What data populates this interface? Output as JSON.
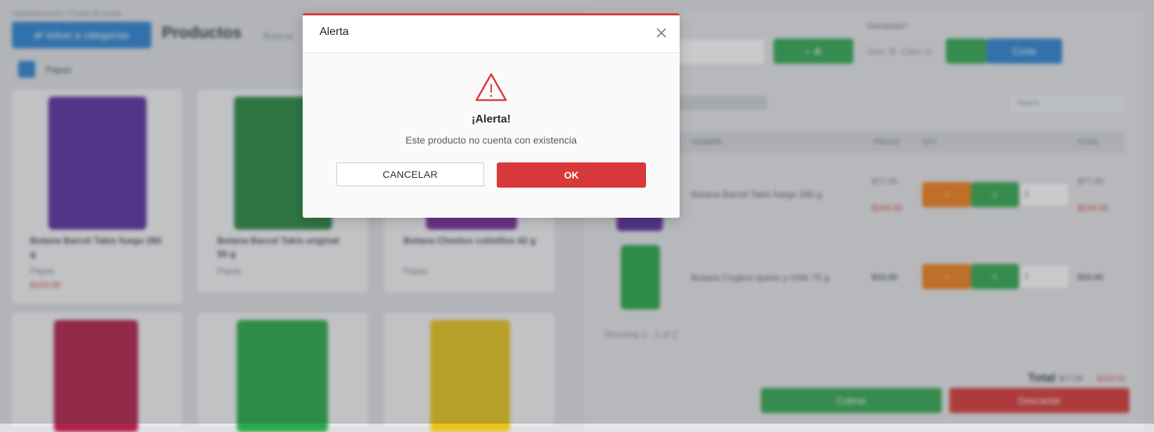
{
  "background": {
    "top_note": "Administración • Punto de venta",
    "back_button_label": "⇄  Volver a categorías",
    "page_title": "Productos",
    "search_label": "Buscar",
    "category_chip": "Papas",
    "seller_label": "Vendedor*",
    "seller_value": "Gen. B. Caso G.",
    "quote_button_label": "Corte",
    "table_search_placeholder": "Search...",
    "columns": [
      "NOMBRE",
      "PRECIO",
      "QTY",
      "TOTAL"
    ],
    "cart_rows": [
      {
        "name": "Botana Barcel Takis fuego 280 g",
        "price": "$77.00",
        "old_price": "$104.00",
        "qty": "1",
        "total": "$77.00",
        "old_total": "$104.00"
      },
      {
        "name": "Botana Crujitos queso y chile 75 g",
        "price": "$10.00",
        "qty": "1",
        "total": "$10.00"
      }
    ],
    "showing": "Showing 1 - 2 of 2",
    "total_label": "Total",
    "total_value": "$77.00",
    "total_old": "$104.00",
    "charge_label": "Cobrar",
    "discard_label": "Descartar",
    "products": [
      {
        "name": "Botana Barcel Takis fuego 280 g",
        "category": "Papas",
        "promo": "$104.00"
      },
      {
        "name": "Botana Barcel Takis original 56 g",
        "category": "Papas"
      },
      {
        "name": "Botana Cheetos colmillos 42 g",
        "category": "Papas"
      }
    ],
    "colors": {
      "bag1": "#5c2fa0",
      "bag2": "#2a8a45",
      "bag3": "#7a2e9e",
      "bag4": "#b0224a",
      "bag5": "#2aa94a",
      "bag6": "#e8c41c"
    }
  },
  "modal": {
    "title": "Alerta",
    "heading": "¡Alerta!",
    "message": "Este producto no cuenta con existencia",
    "cancel_label": "CANCELAR",
    "ok_label": "OK",
    "icon": "warning-triangle-icon",
    "accent_color": "#d93a3a"
  }
}
